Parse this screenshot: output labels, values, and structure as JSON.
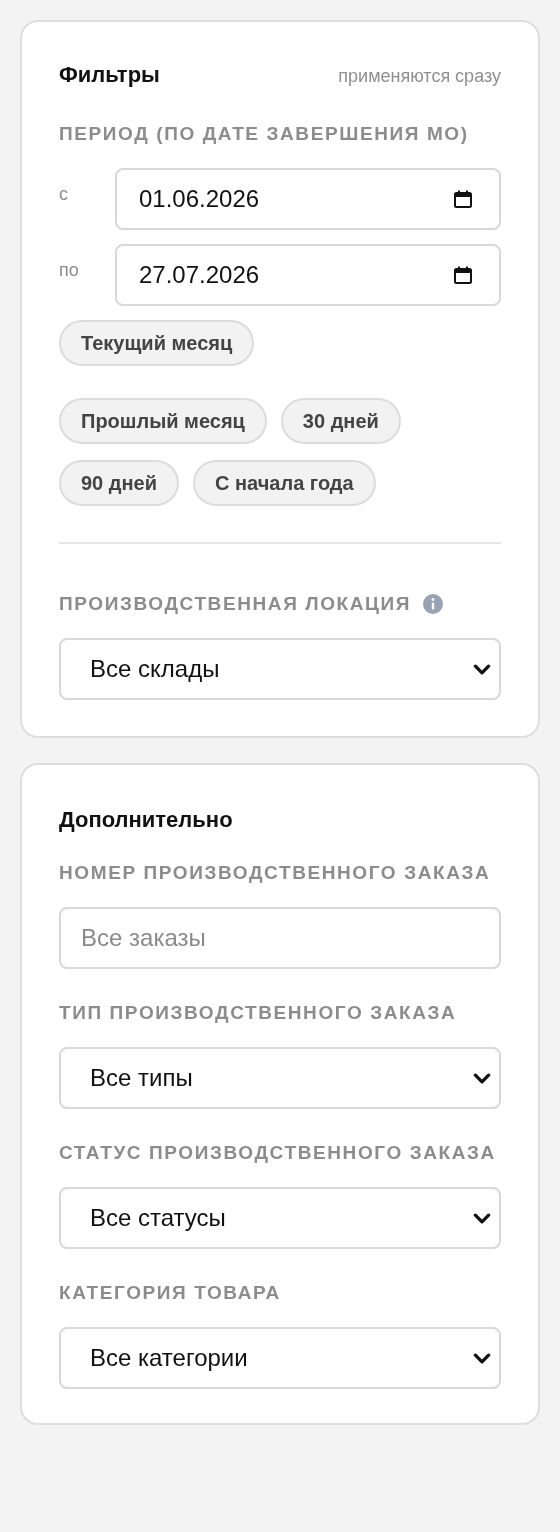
{
  "filters": {
    "title": "Фильтры",
    "hint": "применяются сразу",
    "period_label": "ПЕРИОД (ПО ДАТЕ ЗАВЕРШЕНИЯ МО)",
    "dates": [
      {
        "label": "с",
        "value": "01.06.2026"
      },
      {
        "label": "по",
        "value": "27.07.2026"
      }
    ],
    "presets": [
      {
        "label": "Текущий месяц",
        "selected": false
      },
      {
        "label": "Прошлый месяц",
        "selected": false
      },
      {
        "label": "30 дней",
        "selected": false
      },
      {
        "label": "90 дней",
        "selected": false
      },
      {
        "label": "С начала года",
        "selected": false
      }
    ],
    "location": {
      "label": "ПРОИЗВОДСТВЕННАЯ ЛОКАЦИЯ",
      "value": "Все склады"
    }
  },
  "advanced": {
    "title": "Дополнительно",
    "fields": [
      {
        "kind": "input",
        "label": "НОМЕР ПРОИЗВОДСТВЕННОГО ЗАКАЗА",
        "placeholder": "Все заказы"
      },
      {
        "kind": "select",
        "label": "ТИП ПРОИЗВОДСТВЕННОГО ЗАКАЗА",
        "value": "Все типы"
      },
      {
        "kind": "select",
        "label": "СТАТУС ПРОИЗВОДСТВЕННОГО ЗАКАЗА",
        "value": "Все статусы"
      },
      {
        "kind": "select",
        "label": "КАТЕГОРИЯ ТОВАРА",
        "value": "Все категории"
      }
    ]
  }
}
